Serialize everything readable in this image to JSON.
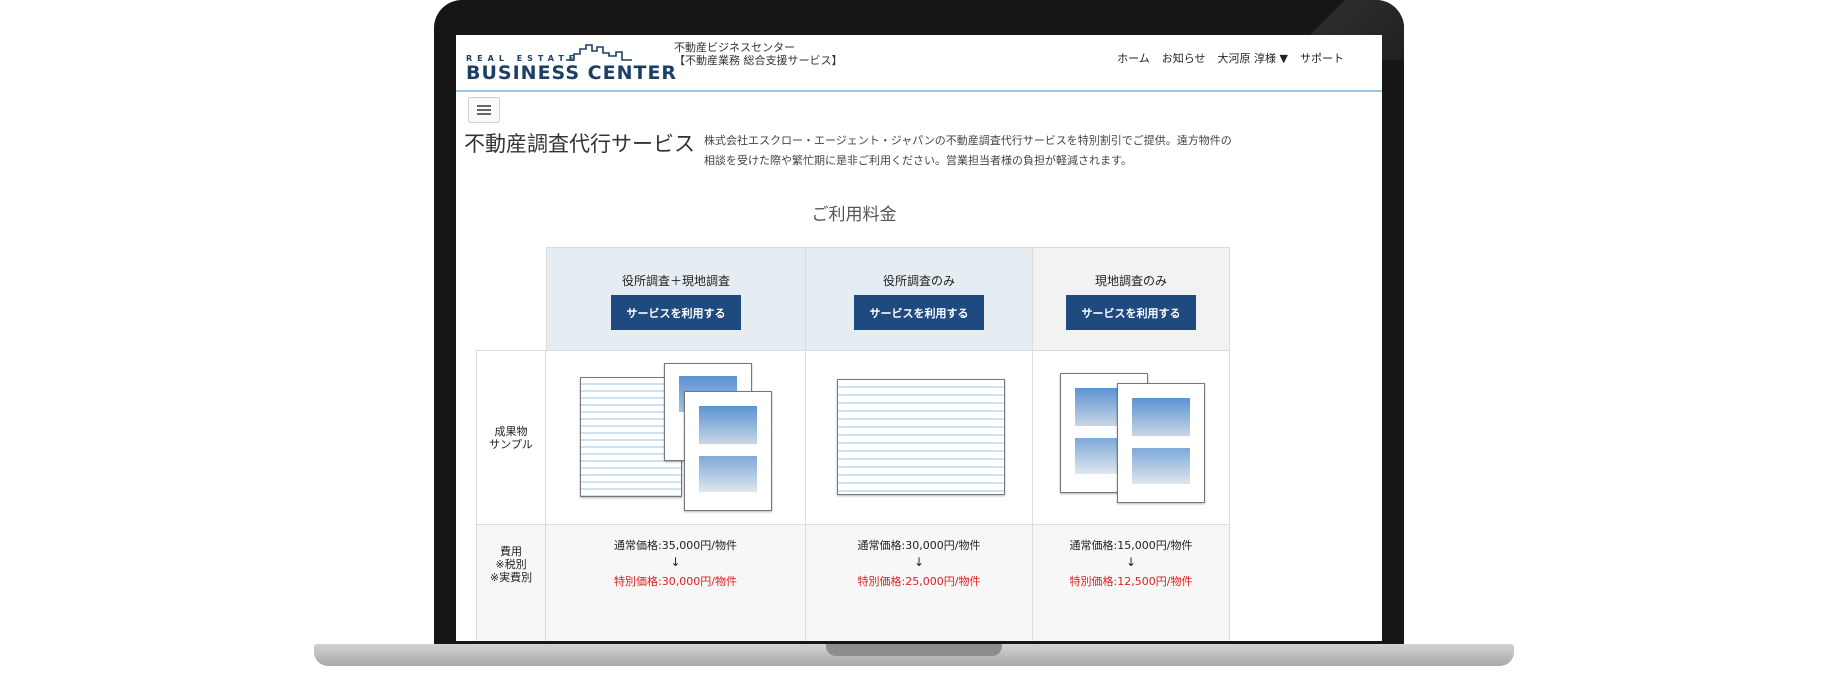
{
  "header": {
    "logo_top": "REAL ESTATE",
    "logo_main": "BUSINESS CENTER",
    "site_name_line1": "不動産ビジネスセンター",
    "site_name_line2": "【不動産業務 総合支援サービス】",
    "nav": [
      "ホーム",
      "お知らせ",
      "大河原 淳様 ▼",
      "サポート"
    ]
  },
  "page": {
    "title": "不動産調査代行サービス",
    "intro": "株式会社エスクロー・エージェント・ジャパンの不動産調査代行サービスを特別割引でご提供。遠方物件の相談を受けた際や繁忙期に是非ご利用ください。営業担当者様の負担が軽減されます。",
    "section_title": "ご利用料金"
  },
  "pricing": {
    "plans": [
      {
        "name": "役所調査＋現地調査",
        "button": "サービスを利用する",
        "regular": "通常価格:35,000円/物件",
        "arrow": "↓",
        "special": "特別価格:30,000円/物件"
      },
      {
        "name": "役所調査のみ",
        "button": "サービスを利用する",
        "regular": "通常価格:30,000円/物件",
        "arrow": "↓",
        "special": "特別価格:25,000円/物件"
      },
      {
        "name": "現地調査のみ",
        "button": "サービスを利用する",
        "regular": "通常価格:15,000円/物件",
        "arrow": "↓",
        "special": "特別価格:12,500円/物件"
      }
    ],
    "row_sample_label": "成果物\nサンプル",
    "row_fee_label": "費用\n※税別\n※実費別"
  },
  "colors": {
    "accent": "#1f4a80",
    "header_blue_bg": "#e6edf2",
    "header_grey_bg": "#f2f2f2",
    "special_price": "#e02020"
  }
}
